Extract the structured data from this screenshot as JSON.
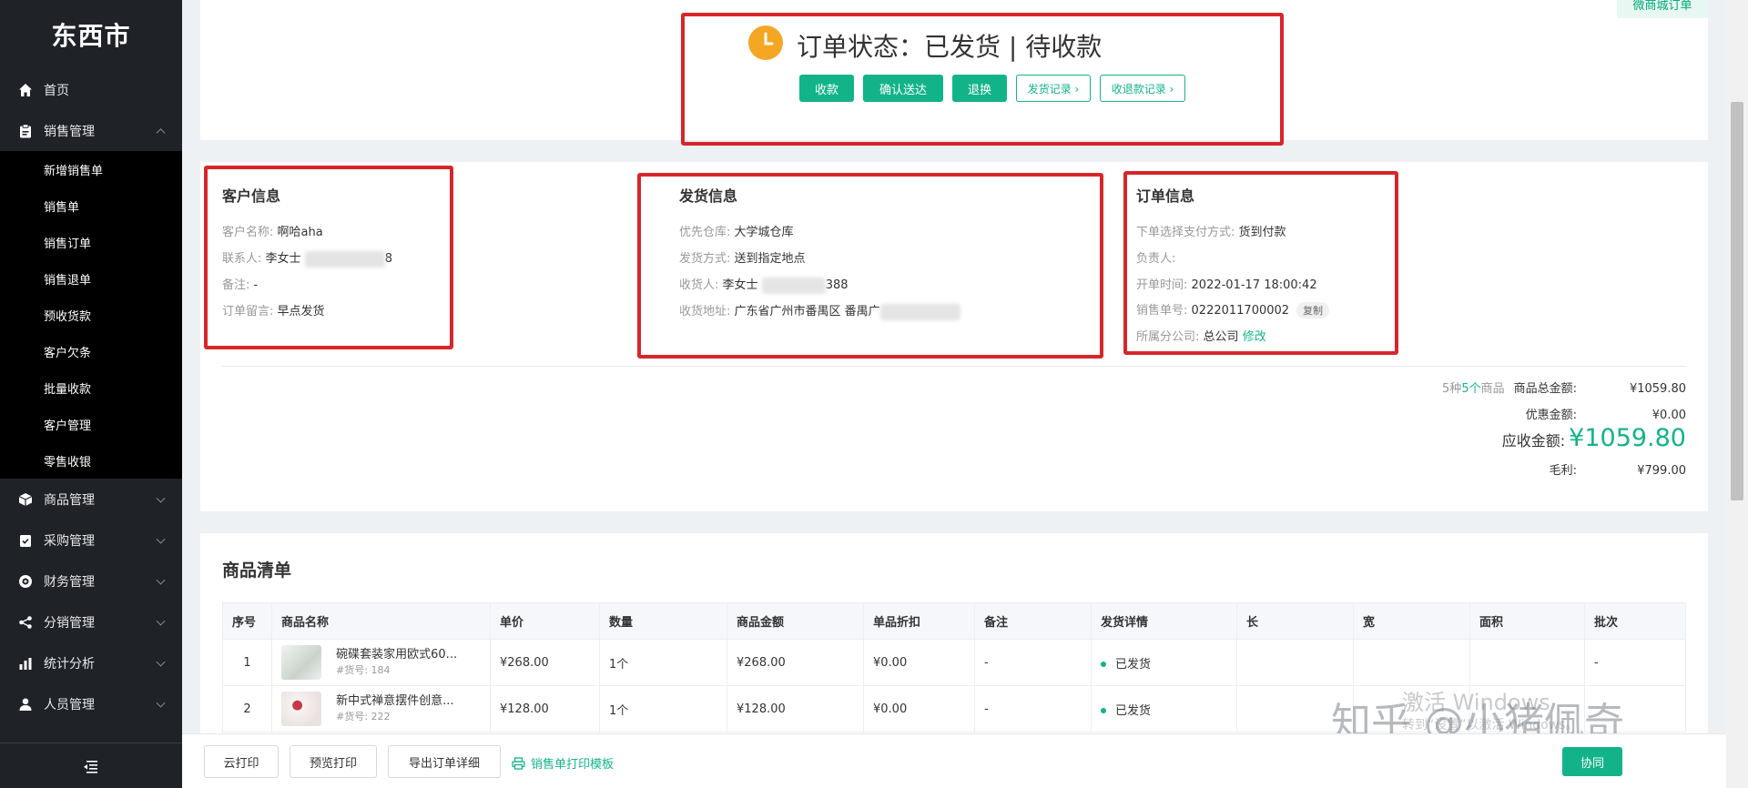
{
  "sidebar": {
    "logo": "东西市",
    "groups": [
      {
        "label": "首页",
        "icon": "home-icon"
      },
      {
        "label": "销售管理",
        "icon": "clipboard-icon",
        "expanded": true,
        "items": [
          "新增销售单",
          "销售单",
          "销售订单",
          "销售退单",
          "预收货款",
          "客户欠条",
          "批量收款",
          "客户管理",
          "零售收银"
        ]
      },
      {
        "label": "商品管理",
        "icon": "box-icon"
      },
      {
        "label": "采购管理",
        "icon": "checklist-icon"
      },
      {
        "label": "财务管理",
        "icon": "finance-icon"
      },
      {
        "label": "分销管理",
        "icon": "share-icon"
      },
      {
        "label": "统计分析",
        "icon": "bar-chart-icon"
      },
      {
        "label": "人员管理",
        "icon": "user-icon"
      }
    ]
  },
  "top_tag": "微商城订单",
  "status": {
    "title": "订单状态：已发货 | 待收款",
    "buttons": {
      "collect": "收款",
      "confirm": "确认送达",
      "return": "退换",
      "ship_log": "发货记录 ›",
      "pay_log": "收退款记录 ›"
    }
  },
  "customer": {
    "title": "客户信息",
    "name_k": "客户名称:",
    "name_v": "啊哈aha",
    "contact_k": "联系人:",
    "contact_v": "李女士",
    "contact_tail": "8",
    "remark_k": "备注:",
    "remark_v": "-",
    "msg_k": "订单留言:",
    "msg_v": "早点发货"
  },
  "shipping": {
    "title": "发货信息",
    "wh_k": "优先仓库:",
    "wh_v": "大学城仓库",
    "method_k": "发货方式:",
    "method_v": "送到指定地点",
    "rcv_k": "收货人:",
    "rcv_v": "李女士",
    "rcv_tail": "388",
    "addr_k": "收货地址:",
    "addr_v": "广东省广州市番禺区 番禺广"
  },
  "order": {
    "title": "订单信息",
    "pay_k": "下单选择支付方式:",
    "pay_v": "货到付款",
    "owner_k": "负责人:",
    "time_k": "开单时间:",
    "time_v": "2022-01-17 18:00:42",
    "no_k": "销售单号:",
    "no_v": "0222011700002",
    "copy": "复制",
    "branch_k": "所属分公司:",
    "branch_v": "总公司",
    "edit": "修改"
  },
  "summary": {
    "kinds_pre": "5种",
    "kinds_count": "5个",
    "kinds_post": "商品",
    "total_k": "商品总金额:",
    "total_v": "¥1059.80",
    "discount_k": "优惠金额:",
    "discount_v": "¥0.00",
    "receivable_k": "应收金额:",
    "receivable_v": "¥1059.80",
    "profit_k": "毛利:",
    "profit_v": "¥799.00"
  },
  "goods": {
    "title": "商品清单",
    "columns": [
      "序号",
      "商品名称",
      "单价",
      "数量",
      "商品金额",
      "单品折扣",
      "备注",
      "发货详情",
      "长",
      "宽",
      "面积",
      "批次"
    ],
    "rows": [
      {
        "no": "1",
        "name": "碗碟套装家用欧式60...",
        "sku": "#货号: 184",
        "price": "¥268.00",
        "qty": "1个",
        "amount": "¥268.00",
        "discount": "¥0.00",
        "remark": "-",
        "ship": "已发货",
        "len": "",
        "wid": "",
        "area": "",
        "batch": "-"
      },
      {
        "no": "2",
        "name": "新中式禅意摆件创意...",
        "sku": "#货号: 222",
        "price": "¥128.00",
        "qty": "1个",
        "amount": "¥128.00",
        "discount": "¥0.00",
        "remark": "-",
        "ship": "已发货",
        "len": "",
        "wid": "",
        "area": "",
        "batch": ""
      }
    ]
  },
  "footer": {
    "cloud_print": "云打印",
    "preview": "预览打印",
    "export": "导出订单详细",
    "template": "销售单打印模板",
    "collab": "协同"
  },
  "watermarks": {
    "zhihu": "知乎 @小猪佩奇",
    "win1": "激活 Windows",
    "win2": "转到“设置”以激活 Windows。"
  },
  "colors": {
    "accent": "#13b38a",
    "status_icon": "#f5a623",
    "highlight": "#d7262a",
    "sidebar_bg": "#1f2227"
  }
}
